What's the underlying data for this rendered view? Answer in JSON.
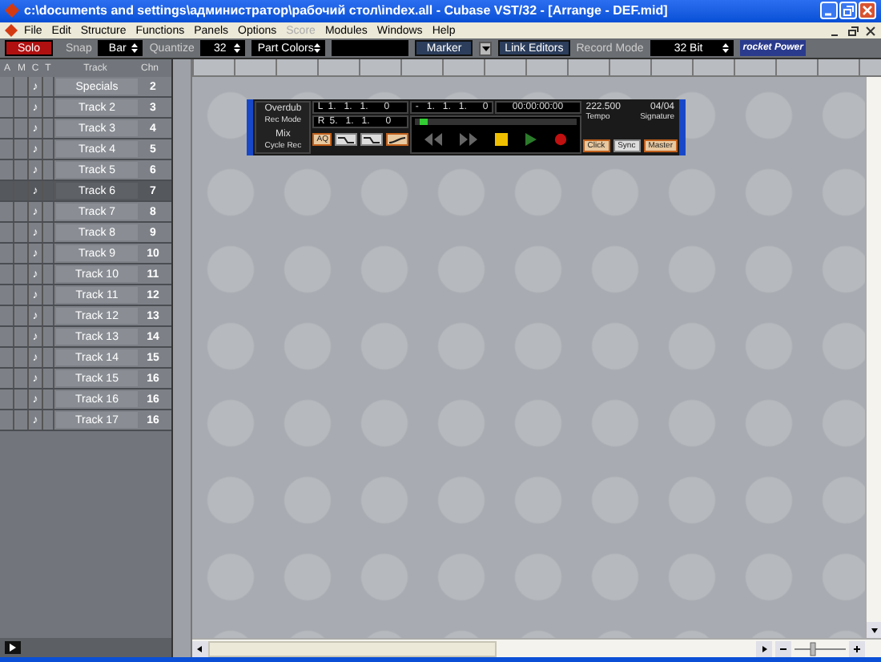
{
  "window": {
    "title": "c:\\documents and settings\\администратор\\рабочий стол\\index.all - Cubase VST/32 - [Arrange - DEF.mid]"
  },
  "menu": [
    {
      "label": "File",
      "disabled": false
    },
    {
      "label": "Edit",
      "disabled": false
    },
    {
      "label": "Structure",
      "disabled": false
    },
    {
      "label": "Functions",
      "disabled": false
    },
    {
      "label": "Panels",
      "disabled": false
    },
    {
      "label": "Options",
      "disabled": false
    },
    {
      "label": "Score",
      "disabled": true
    },
    {
      "label": "Modules",
      "disabled": false
    },
    {
      "label": "Windows",
      "disabled": false
    },
    {
      "label": "Help",
      "disabled": false
    }
  ],
  "toolbar": {
    "solo": {
      "label": "Solo",
      "on": true
    },
    "snap": {
      "label": "Snap",
      "value": "Bar"
    },
    "quantize": {
      "label": "Quantize",
      "value": "32"
    },
    "part_colors": "Part Colors",
    "marker": "Marker",
    "link_editors": "Link Editors",
    "record_mode": {
      "label": "Record Mode",
      "value": "32 Bit"
    },
    "rocket": "rocket Power"
  },
  "track_columns": [
    "A",
    "M",
    "C",
    "T",
    "Track",
    "Chn"
  ],
  "tracks": [
    {
      "c": "♪",
      "name": "Specials",
      "chn": "2",
      "selected": false
    },
    {
      "c": "♪",
      "name": "Track 2",
      "chn": "3",
      "selected": false
    },
    {
      "c": "♪",
      "name": "Track 3",
      "chn": "4",
      "selected": false
    },
    {
      "c": "♪",
      "name": "Track 4",
      "chn": "5",
      "selected": false
    },
    {
      "c": "♪",
      "name": "Track 5",
      "chn": "6",
      "selected": false
    },
    {
      "c": "♪",
      "name": "Track 6",
      "chn": "7",
      "selected": true
    },
    {
      "c": "♪",
      "name": "Track 7",
      "chn": "8",
      "selected": false
    },
    {
      "c": "♪",
      "name": "Track 8",
      "chn": "9",
      "selected": false
    },
    {
      "c": "♪",
      "name": "Track 9",
      "chn": "10",
      "selected": false
    },
    {
      "c": "♪",
      "name": "Track 10",
      "chn": "11",
      "selected": false
    },
    {
      "c": "♪",
      "name": "Track 11",
      "chn": "12",
      "selected": false
    },
    {
      "c": "♪",
      "name": "Track 12",
      "chn": "13",
      "selected": false
    },
    {
      "c": "♪",
      "name": "Track 13",
      "chn": "14",
      "selected": false
    },
    {
      "c": "♪",
      "name": "Track 14",
      "chn": "15",
      "selected": false
    },
    {
      "c": "♪",
      "name": "Track 15",
      "chn": "16",
      "selected": false
    },
    {
      "c": "♪",
      "name": "Track 16",
      "chn": "16",
      "selected": false
    },
    {
      "c": "♪",
      "name": "Track 17",
      "chn": "16",
      "selected": false
    }
  ],
  "transport": {
    "rec_mode": "Overdub",
    "rec_mode_label": "Rec Mode",
    "cycle_mode": "Mix",
    "cycle_label": "Cycle Rec",
    "locators": [
      {
        "label": "L",
        "value": "1.   1.   1.      0"
      },
      {
        "label": "R",
        "value": "5.   1.   1.      0"
      }
    ],
    "aq": {
      "label": "AQ",
      "on": true
    },
    "position": "-   1.   1.   1.      0",
    "time": "00:00:00:00",
    "position_slider": {
      "level": 0.03
    },
    "tempo": "222.500",
    "signature": "04/04",
    "tempo_label": "Tempo",
    "signature_label": "Signature",
    "sync_buttons": [
      {
        "label": "Click",
        "on": true
      },
      {
        "label": "Sync",
        "on": false
      },
      {
        "label": "Master",
        "on": true
      }
    ]
  }
}
